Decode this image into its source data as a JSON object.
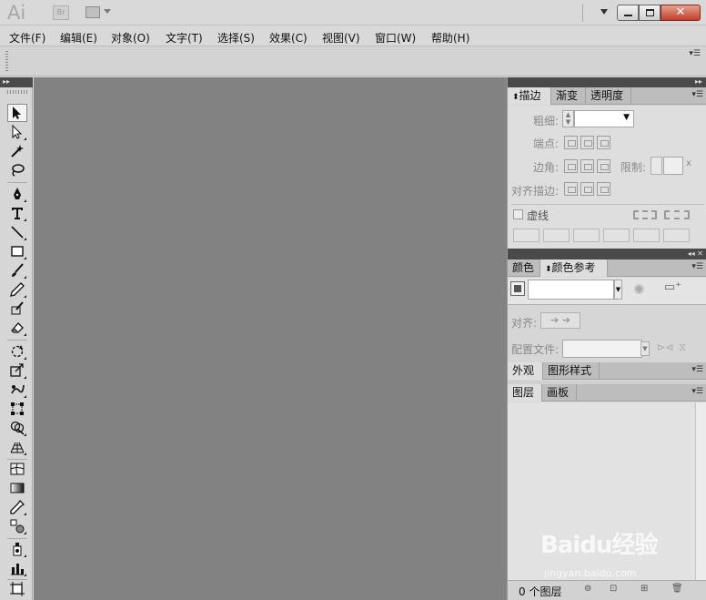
{
  "titlebar": {
    "app_logo": "Ai",
    "bridge_label": "Br",
    "close_label": "✕"
  },
  "menu": [
    {
      "label": "文件(F)"
    },
    {
      "label": "编辑(E)"
    },
    {
      "label": "对象(O)"
    },
    {
      "label": "文字(T)"
    },
    {
      "label": "选择(S)"
    },
    {
      "label": "效果(C)"
    },
    {
      "label": "视图(V)"
    },
    {
      "label": "窗口(W)"
    },
    {
      "label": "帮助(H)"
    }
  ],
  "tools": [
    "selection-tool",
    "direct-selection-tool",
    "magic-wand-tool",
    "lasso-tool",
    "pen-tool",
    "type-tool",
    "line-segment-tool",
    "rectangle-tool",
    "paintbrush-tool",
    "pencil-tool",
    "blob-brush-tool",
    "eraser-tool",
    "rotate-tool",
    "scale-tool",
    "warp-tool",
    "free-transform-tool",
    "shape-builder-tool",
    "graph-tool",
    "mesh-tool",
    "gradient-tool",
    "eyedropper-tool",
    "blend-tool",
    "symbol-sprayer-tool",
    "column-graph-tool",
    "artboard-tool"
  ],
  "stroke_panel": {
    "tabs": [
      "描边",
      "渐变",
      "透明度"
    ],
    "weight_label": "粗细:",
    "cap_label": "端点:",
    "corner_label": "边角:",
    "limit_label": "限制:",
    "limit_suffix": "x",
    "align_label": "对齐描边:",
    "dashed_label": "虚线"
  },
  "color_panel": {
    "tabs": [
      "颜色",
      "颜色参考"
    ],
    "align_label": "对齐:",
    "profile_label": "配置文件:"
  },
  "appearance_panel": {
    "tabs": [
      "外观",
      "图形样式"
    ]
  },
  "layers_panel": {
    "tabs": [
      "图层",
      "画板"
    ],
    "status": "0 个图层"
  },
  "watermark": {
    "logo": "Baidu经验",
    "url": "jingyan.baidu.com"
  }
}
